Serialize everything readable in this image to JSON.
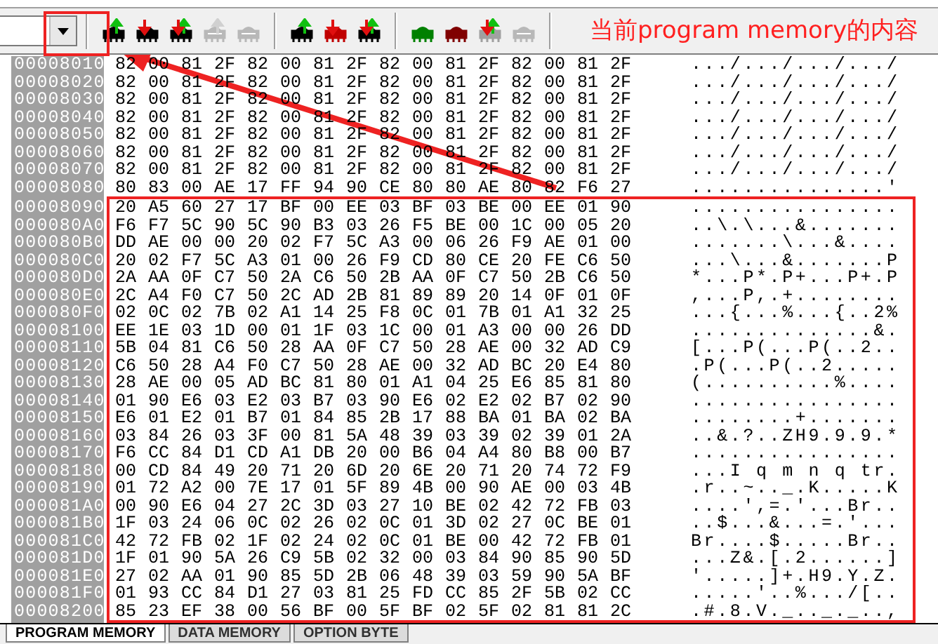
{
  "toolbar": {
    "groups": [
      [
        {
          "color": "#000000",
          "kind": "upload",
          "disabled": false
        },
        {
          "color": "#000000",
          "kind": "download",
          "disabled": false
        },
        {
          "color": "#000000",
          "kind": "exchange",
          "disabled": false
        },
        {
          "color": "#b8b8b8",
          "kind": "upload",
          "disabled": true
        },
        {
          "color": "#b8b8b8",
          "kind": "plain",
          "disabled": true
        }
      ],
      [
        {
          "color": "#000000",
          "kind": "upload",
          "disabled": false
        },
        {
          "color": "#c00000",
          "kind": "download",
          "disabled": false
        },
        {
          "color": "#000000",
          "kind": "exchange",
          "disabled": false
        }
      ],
      [
        {
          "color": "#008000",
          "kind": "plain",
          "disabled": false
        },
        {
          "color": "#800000",
          "kind": "plain",
          "disabled": false
        },
        {
          "color": "#a0a0a0",
          "kind": "exchange",
          "disabled": false
        },
        {
          "color": "#b8b8b8",
          "kind": "plain",
          "disabled": true
        }
      ]
    ]
  },
  "rows": [
    {
      "address": "00008010",
      "hex": "82 00 81 2F 82 00 81 2F 82 00 81 2F 82 00 81 2F",
      "ascii": ".../.../.../.../"
    },
    {
      "address": "00008020",
      "hex": "82 00 81 2F 82 00 81 2F 82 00 81 2F 82 00 81 2F",
      "ascii": ".../.../.../.../"
    },
    {
      "address": "00008030",
      "hex": "82 00 81 2F 82 00 81 2F 82 00 81 2F 82 00 81 2F",
      "ascii": ".../.../.../.../"
    },
    {
      "address": "00008040",
      "hex": "82 00 81 2F 82 00 81 2F 82 00 81 2F 82 00 81 2F",
      "ascii": ".../.../.../.../"
    },
    {
      "address": "00008050",
      "hex": "82 00 81 2F 82 00 81 2F 82 00 81 2F 82 00 81 2F",
      "ascii": ".../.../.../.../"
    },
    {
      "address": "00008060",
      "hex": "82 00 81 2F 82 00 81 2F 82 00 81 2F 82 00 81 2F",
      "ascii": ".../.../.../.../"
    },
    {
      "address": "00008070",
      "hex": "82 00 81 2F 82 00 81 2F 82 00 81 2F 82 00 81 2F",
      "ascii": ".../.../.../.../"
    },
    {
      "address": "00008080",
      "hex": "80 83 00 AE 17 FF 94 90 CE 80 80 AE 80 82 F6 27",
      "ascii": "...............'"
    },
    {
      "address": "00008090",
      "hex": "20 A5 60 27 17 BF 00 EE 03 BF 03 BE 00 EE 01 90",
      "ascii": "................"
    },
    {
      "address": "000080A0",
      "hex": "F6 F7 5C 90 5C 90 B3 03 26 F5 BE 00 1C 00 05 20",
      "ascii": "..\\.\\...&......."
    },
    {
      "address": "000080B0",
      "hex": "DD AE 00 00 20 02 F7 5C A3 00 06 26 F9 AE 01 00",
      "ascii": ".......\\...&...."
    },
    {
      "address": "000080C0",
      "hex": "20 02 F7 5C A3 01 00 26 F9 CD 80 CE 20 FE C6 50",
      "ascii": "...\\...&.......P"
    },
    {
      "address": "000080D0",
      "hex": "2A AA 0F C7 50 2A C6 50 2B AA 0F C7 50 2B C6 50",
      "ascii": "*...P*.P+...P+.P"
    },
    {
      "address": "000080E0",
      "hex": "2C A4 F0 C7 50 2C AD 2B 81 89 89 20 14 0F 01 0F",
      "ascii": ",...P,.+........"
    },
    {
      "address": "000080F0",
      "hex": "02 0C 02 7B 02 A1 14 25 F8 0C 01 7B 01 A1 32 25",
      "ascii": "...{...%...{..2%"
    },
    {
      "address": "00008100",
      "hex": "EE 1E 03 1D 00 01 1F 03 1C 00 01 A3 00 00 26 DD",
      "ascii": "..............&."
    },
    {
      "address": "00008110",
      "hex": "5B 04 81 C6 50 28 AA 0F C7 50 28 AE 00 32 AD C9",
      "ascii": "[...P(...P(..2.."
    },
    {
      "address": "00008120",
      "hex": "C6 50 28 A4 F0 C7 50 28 AE 00 32 AD BC 20 E4 80",
      "ascii": ".P(...P(..2....."
    },
    {
      "address": "00008130",
      "hex": "28 AE 00 05 AD BC 81 80 01 A1 04 25 E6 85 81 80",
      "ascii": "(..........%...."
    },
    {
      "address": "00008140",
      "hex": "01 90 E6 03 E2 03 B7 03 90 E6 02 E2 02 B7 02 90",
      "ascii": "................"
    },
    {
      "address": "00008150",
      "hex": "E6 01 E2 01 B7 01 84 85 2B 17 88 BA 01 BA 02 BA",
      "ascii": "........+......."
    },
    {
      "address": "00008160",
      "hex": "03 84 26 03 3F 00 81 5A 48 39 03 39 02 39 01 2A",
      "ascii": "..&.?..ZH9.9.9.*"
    },
    {
      "address": "00008170",
      "hex": "F6 CC 84 D1 CD A1 DB 20 00 B6 04 A4 80 B8 00 B7",
      "ascii": "................"
    },
    {
      "address": "00008180",
      "hex": "00 CD 84 49 20 71 20 6D 20 6E 20 71 20 74 72 F9",
      "ascii": "...I q m n q tr."
    },
    {
      "address": "00008190",
      "hex": "01 72 A2 00 7E 17 01 5F 89 4B 00 90 AE 00 03 4B",
      "ascii": ".r..~.._.K.....K"
    },
    {
      "address": "000081A0",
      "hex": "00 90 E6 04 27 2C 3D 03 27 10 BE 02 42 72 FB 03",
      "ascii": "....',=.'...Br.."
    },
    {
      "address": "000081B0",
      "hex": "1F 03 24 06 0C 02 26 02 0C 01 3D 02 27 0C BE 01",
      "ascii": "..$...&...=.'..."
    },
    {
      "address": "000081C0",
      "hex": "42 72 FB 02 1F 02 24 02 0C 01 BE 00 42 72 FB 01",
      "ascii": "Br....$.....Br.."
    },
    {
      "address": "000081D0",
      "hex": "1F 01 90 5A 26 C9 5B 02 32 00 03 84 90 85 90 5D",
      "ascii": "...Z&.[.2......]"
    },
    {
      "address": "000081E0",
      "hex": "27 02 AA 01 90 85 5D 2B 06 48 39 03 59 90 5A BF",
      "ascii": "'.....]+.H9.Y.Z."
    },
    {
      "address": "000081F0",
      "hex": "01 93 CC 84 D1 27 03 81 25 FD CC 85 2F 5B 02 CC",
      "ascii": ".....'..%.../[.."
    },
    {
      "address": "00008200",
      "hex": "85 23 EF 38 00 56 BF 00 5F BF 02 5F 02 81 81 2C",
      "ascii": ".#.8.V._.._._..,"
    }
  ],
  "tabs": [
    {
      "label": "PROGRAM MEMORY",
      "selected": true
    },
    {
      "label": "DATA MEMORY",
      "selected": false
    },
    {
      "label": "OPTION BYTE",
      "selected": false
    }
  ],
  "annotation": {
    "label": "当前program memory的内容"
  }
}
